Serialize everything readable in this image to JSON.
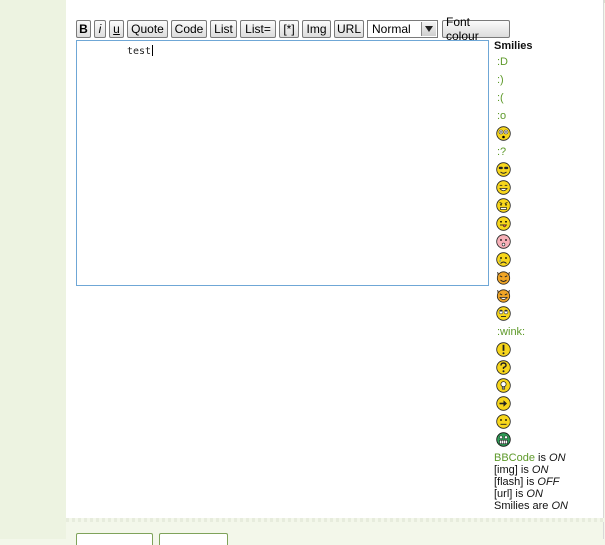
{
  "toolbar": {
    "buttons": [
      "B",
      "i",
      "u",
      "Quote",
      "Code",
      "List",
      "List=",
      "[*]",
      "Img",
      "URL"
    ],
    "size_select_value": "Normal",
    "font_colour_label": "Font colour"
  },
  "editor": {
    "text": "test"
  },
  "smilies": {
    "title": "Smilies",
    "items": [
      {
        "type": "text",
        "label": ":D"
      },
      {
        "type": "text",
        "label": ":)"
      },
      {
        "type": "text",
        "label": ":("
      },
      {
        "type": "text",
        "label": ":o"
      },
      {
        "type": "icon",
        "icon": "shocked-smiley-icon"
      },
      {
        "type": "text",
        "label": ":?"
      },
      {
        "type": "icon",
        "icon": "cool-smiley-icon"
      },
      {
        "type": "icon",
        "icon": "laughing-smiley-icon"
      },
      {
        "type": "icon",
        "icon": "mad-smiley-icon"
      },
      {
        "type": "icon",
        "icon": "tongue-smiley-icon"
      },
      {
        "type": "icon",
        "icon": "embarrassed-smiley-icon"
      },
      {
        "type": "icon",
        "icon": "crying-smiley-icon"
      },
      {
        "type": "icon",
        "icon": "evil-smiley-icon"
      },
      {
        "type": "icon",
        "icon": "twisted-smiley-icon"
      },
      {
        "type": "icon",
        "icon": "rolleyes-smiley-icon"
      },
      {
        "type": "text",
        "label": ":wink:"
      },
      {
        "type": "icon",
        "icon": "exclaim-icon"
      },
      {
        "type": "icon",
        "icon": "question-icon"
      },
      {
        "type": "icon",
        "icon": "idea-icon"
      },
      {
        "type": "icon",
        "icon": "arrow-icon"
      },
      {
        "type": "icon",
        "icon": "neutral-smiley-icon"
      },
      {
        "type": "icon",
        "icon": "mrgreen-smiley-icon"
      }
    ]
  },
  "status": {
    "bbcode_link": "BBCode",
    "bbcode_is": " is ",
    "bbcode_state": "ON",
    "img_label": "[img] is ",
    "img_state": "ON",
    "flash_label": "[flash] is ",
    "flash_state": "OFF",
    "url_label": "[url] is ",
    "url_state": "ON",
    "smilies_label": "Smilies are ",
    "smilies_state": "ON"
  },
  "colors": {
    "accent_green": "#5e9a2a",
    "editor_border": "#6fa7d6",
    "smiley_yellow": "#f7d61c"
  }
}
